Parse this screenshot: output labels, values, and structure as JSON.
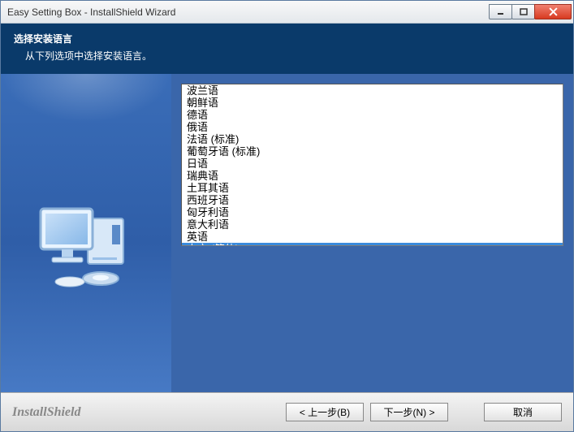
{
  "window": {
    "title": "Easy Setting Box - InstallShield Wizard"
  },
  "header": {
    "title": "选择安装语言",
    "subtitle": "从下列选项中选择安装语言。"
  },
  "languages": {
    "items": [
      "波兰语",
      "朝鲜语",
      "德语",
      "俄语",
      "法语 (标准)",
      "葡萄牙语 (标准)",
      "日语",
      "瑞典语",
      "土耳其语",
      "西班牙语",
      "匈牙利语",
      "意大利语",
      "英语",
      "中文 (简体)"
    ],
    "selected_index": 13
  },
  "footer": {
    "brand": "InstallShield",
    "back": "< 上一步(B)",
    "next": "下一步(N) >",
    "cancel": "取消"
  }
}
